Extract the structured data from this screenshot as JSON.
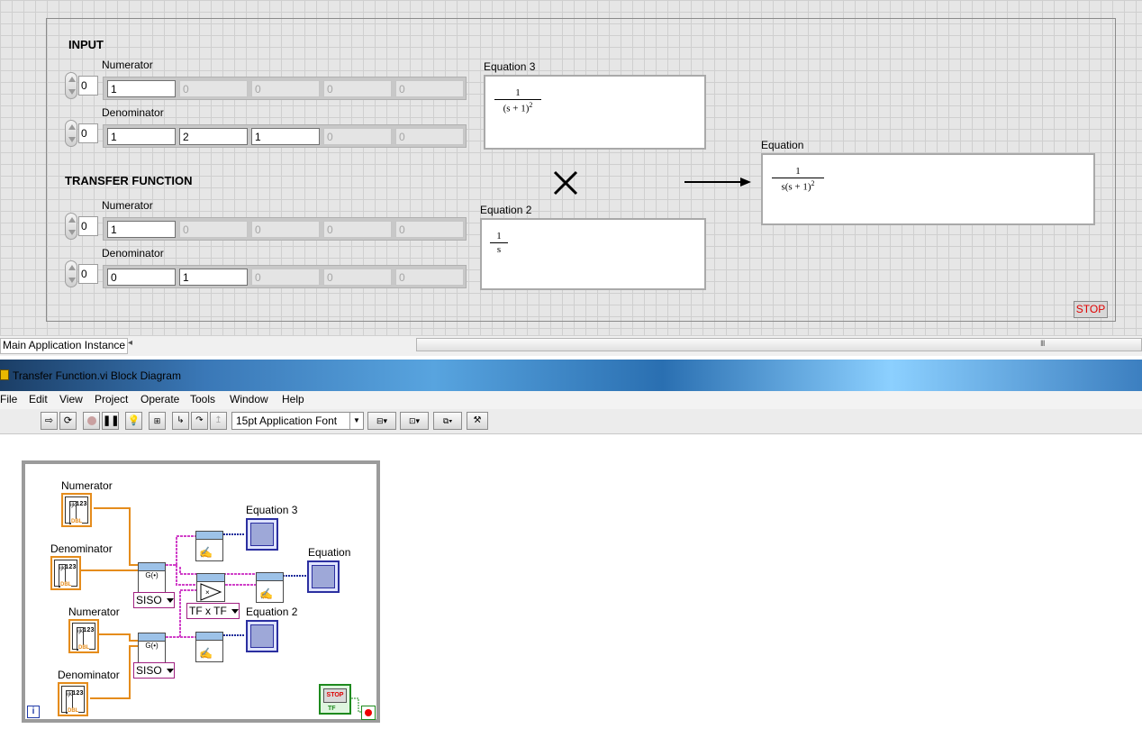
{
  "front_panel": {
    "input_title": "INPUT",
    "tf_title": "TRANSFER FUNCTION",
    "input_numerator": {
      "label": "Numerator",
      "index": "0",
      "values": [
        "1",
        "0",
        "0",
        "0",
        "0"
      ]
    },
    "input_denominator": {
      "label": "Denominator",
      "index": "0",
      "values": [
        "1",
        "2",
        "1",
        "0",
        "0"
      ]
    },
    "tf_numerator": {
      "label": "Numerator",
      "index": "0",
      "values": [
        "1",
        "0",
        "0",
        "0",
        "0"
      ]
    },
    "tf_denominator": {
      "label": "Denominator",
      "index": "0",
      "values": [
        "0",
        "1",
        "0",
        "0",
        "0"
      ]
    },
    "equation3": {
      "label": "Equation 3",
      "num": "1",
      "den": "(s + 1)",
      "den_exp": "2"
    },
    "equation2": {
      "label": "Equation 2",
      "num": "1",
      "den": "s"
    },
    "equation": {
      "label": "Equation",
      "num": "1",
      "den": "s(s + 1)",
      "den_exp": "2"
    },
    "stop_label": "STOP"
  },
  "status_bar": {
    "app_instance": "Main Application Instance",
    "scroll_left": "◂",
    "scroll_grip": "III"
  },
  "window": {
    "title": "Transfer Function.vi Block Diagram"
  },
  "menu": {
    "file": "File",
    "edit": "Edit",
    "view": "View",
    "project": "Project",
    "operate": "Operate",
    "tools": "Tools",
    "window": "Window",
    "help": "Help"
  },
  "toolbar": {
    "font": "15pt Application Font"
  },
  "block_diagram": {
    "num1_label": "Numerator",
    "den1_label": "Denominator",
    "num2_label": "Numerator",
    "den2_label": "Denominator",
    "eq3_label": "Equation 3",
    "eq_label": "Equation",
    "eq2_label": "Equation 2",
    "ring1": "SISO",
    "ring2": "SISO",
    "ring_mult": "TF x TF",
    "terminal_type": "DBL",
    "terminal_num": "123",
    "stop_text": "STOP",
    "stop_type": "TF",
    "loop_iter": "i",
    "gfunc": "G(•)"
  },
  "colors": {
    "wire_orange": "#e58c1c",
    "wire_pink": "#d040c8",
    "wire_blue": "#1a2a9a",
    "stop_red": "#e00000"
  }
}
